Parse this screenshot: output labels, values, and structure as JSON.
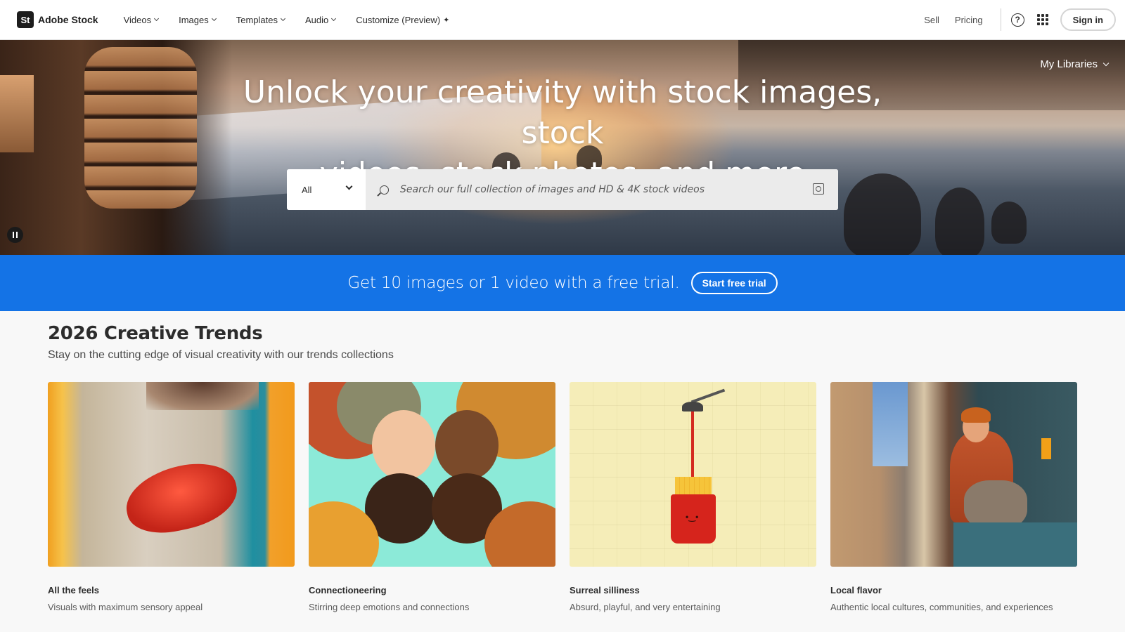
{
  "brand": {
    "mark": "St",
    "name": "Adobe Stock"
  },
  "nav": {
    "items": [
      {
        "label": "Videos"
      },
      {
        "label": "Images"
      },
      {
        "label": "Templates"
      },
      {
        "label": "Audio"
      },
      {
        "label": "Customize (Preview)"
      }
    ],
    "sell": "Sell",
    "pricing": "Pricing",
    "sign_in": "Sign in"
  },
  "hero": {
    "title_line1": "Unlock your creativity with stock images, stock",
    "title_line2": "videos, stock photos, and more",
    "my_libraries": "My Libraries",
    "search": {
      "type_selected": "All",
      "placeholder": "Search our full collection of images and HD & 4K stock videos"
    }
  },
  "trial": {
    "text": "Get 10 images or 1 video with a free trial.",
    "button": "Start free trial"
  },
  "trends": {
    "title": "2026 Creative Trends",
    "subtitle": "Stay on the cutting edge of visual creativity with our trends collections",
    "cards": [
      {
        "title": "All the feels",
        "description": "Visuals with maximum sensory appeal"
      },
      {
        "title": "Connectioneering",
        "description": "Stirring deep emotions and connections"
      },
      {
        "title": "Surreal silliness",
        "description": "Absurd, playful, and very entertaining"
      },
      {
        "title": "Local flavor",
        "description": "Authentic local cultures, communities, and experiences"
      }
    ]
  },
  "colors": {
    "accent_blue": "#1473e6",
    "nav_bg": "#ffffff",
    "page_bg": "#f8f8f8"
  },
  "icons": [
    "help-icon",
    "apps-grid-icon",
    "search-icon",
    "visual-search-icon",
    "pause-icon",
    "chevron-down-icon",
    "sparkle-icon"
  ]
}
